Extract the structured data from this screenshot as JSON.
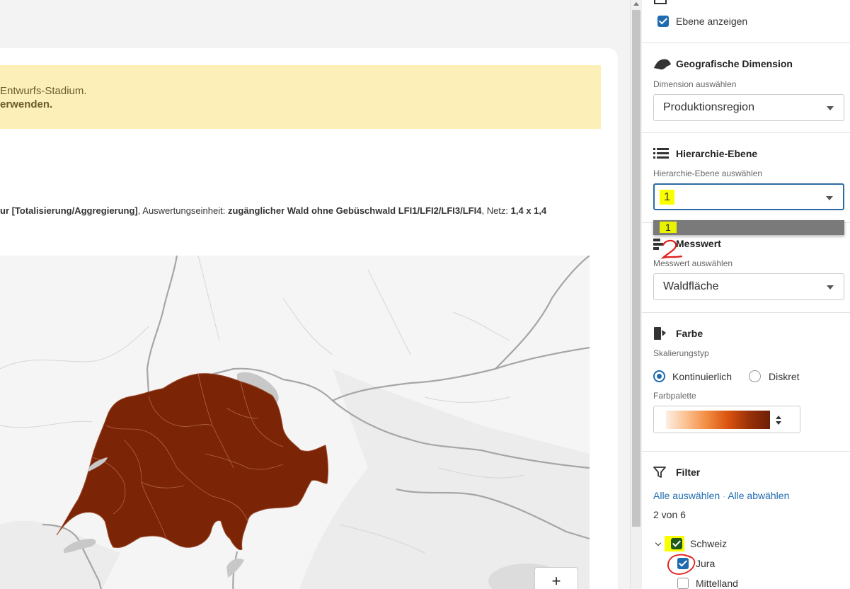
{
  "warning": {
    "line1": "Entwurfs-Stadium.",
    "line2": "erwenden."
  },
  "meta": {
    "part1": "ur [Totalisierung/Aggregierung]",
    "part2": ", Auswertungseinheit: ",
    "part3": "zugänglicher Wald ohne Gebüschwald LFI1/LFI2/LFI3/LFI4",
    "part4": ", Netz: ",
    "part5": "1,4 x 1,4"
  },
  "map": {
    "zoom_in_label": "+",
    "fill_color": "#7b2506",
    "zoom_level": 1
  },
  "layer": {
    "show_label": "Ebene anzeigen",
    "show_checked": true
  },
  "geo": {
    "title": "Geografische Dimension",
    "select_label": "Dimension auswählen",
    "value": "Produktionsregion"
  },
  "hierarchy": {
    "title": "Hierarchie-Ebene",
    "select_label": "Hierarchie-Ebene auswählen",
    "value": "1",
    "options": [
      "1"
    ]
  },
  "measure": {
    "title": "Messwert",
    "select_label": "Messwert auswählen",
    "value": "Waldfläche"
  },
  "color": {
    "title": "Farbe",
    "scale_label": "Skalierungstyp",
    "option_continuous": "Kontinuierlich",
    "option_discrete": "Diskret",
    "selected": "Kontinuierlich",
    "palette_label": "Farbpalette",
    "palette": [
      "#fcefe4",
      "#fbbf8e",
      "#f18a3f",
      "#d9520f",
      "#983108",
      "#6e2006"
    ]
  },
  "filter": {
    "title": "Filter",
    "select_all": "Alle auswählen",
    "separator": "·",
    "deselect_all": "Alle abwählen",
    "count": "2 von 6",
    "items": [
      {
        "label": "Schweiz",
        "checked": true
      },
      {
        "label": "Jura",
        "checked": true
      },
      {
        "label": "Mittelland",
        "checked": false
      }
    ]
  },
  "annotation": {
    "step_number": "2"
  },
  "colors": {
    "accent": "#1f6bb0",
    "warning_bg": "#fcf0b8",
    "highlight": "#faff00",
    "annotation_red": "#e0201c"
  }
}
